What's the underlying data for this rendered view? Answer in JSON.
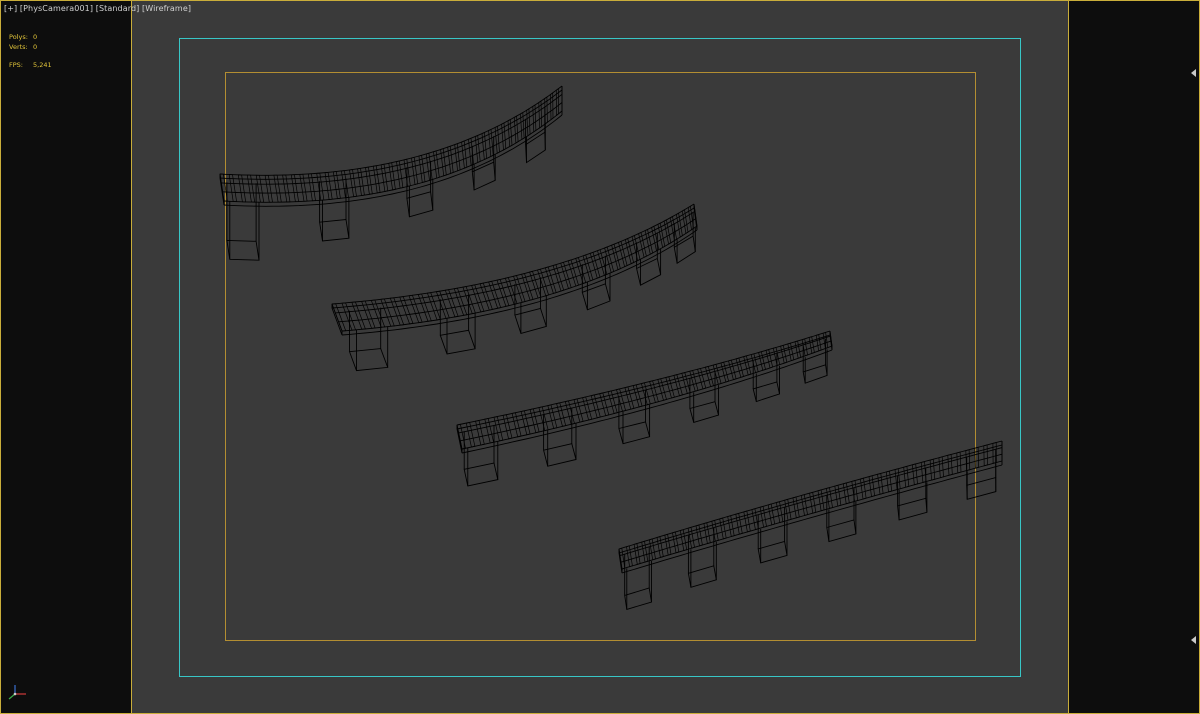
{
  "viewport": {
    "label": "[+] [PhysCamera001] [Standard] [Wireframe]",
    "shading_mode": "Wireframe",
    "camera": "PhysCamera001",
    "view_preset": "Standard"
  },
  "stats": {
    "polys_label": "Polys:",
    "polys_value": "0",
    "verts_label": "Verts:",
    "verts_value": "0",
    "fps_label": "FPS:",
    "fps_value": "5,241"
  },
  "colors": {
    "viewport_background": "#3a3a3a",
    "outer_background": "#0d0d0d",
    "active_border": "#c9ad3a",
    "safe_frame": "#38c6c6",
    "action_frame": "#b38e32",
    "wireframe": "#000000",
    "stats_text": "#e3c63a"
  },
  "scene": {
    "objects": [
      {
        "name": "curved-walkway-strong",
        "curvature": "strong",
        "supports": 5
      },
      {
        "name": "curved-walkway-medium",
        "curvature": "medium",
        "supports": 6
      },
      {
        "name": "curved-walkway-slight",
        "curvature": "slight",
        "supports": 6
      },
      {
        "name": "straight-walkway",
        "curvature": "none",
        "supports": 6
      }
    ]
  },
  "icons": {
    "axis_gizmo": "xyz-axis-tripod-icon",
    "frame_marker": "triangle-marker-icon"
  }
}
